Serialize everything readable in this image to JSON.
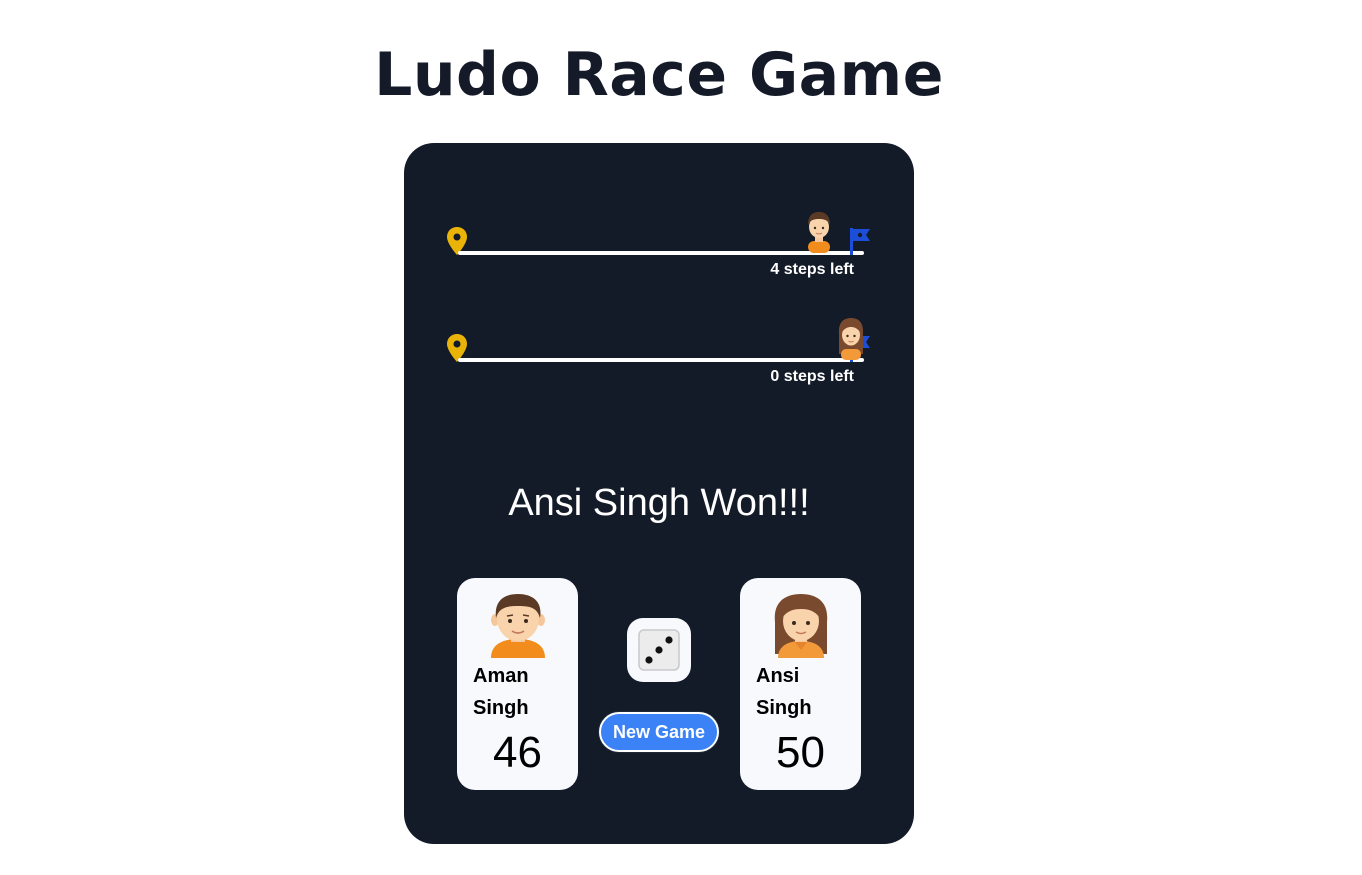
{
  "page": {
    "title": "Ludo Race Game"
  },
  "tracks": [
    {
      "player": "Aman Singh",
      "steps_left": "4 steps left",
      "progress": 0.92
    },
    {
      "player": "Ansi Singh",
      "steps_left": "0 steps left",
      "progress": 1.0
    }
  ],
  "status": {
    "winner_text": "Ansi Singh Won!!!"
  },
  "players": [
    {
      "first": "Aman",
      "last": "Singh",
      "score": "46",
      "avatar": "boy-avatar-icon"
    },
    {
      "first": "Ansi",
      "last": "Singh",
      "score": "50",
      "avatar": "girl-avatar-icon"
    }
  ],
  "dice": {
    "value": 3,
    "icon": "dice-three-icon"
  },
  "controls": {
    "new_game_label": "New Game"
  },
  "colors": {
    "board": "#131a28",
    "pin": "#eab308",
    "flag": "#1d4ed8",
    "button": "#3b82f6",
    "card": "#f7f9fc"
  }
}
